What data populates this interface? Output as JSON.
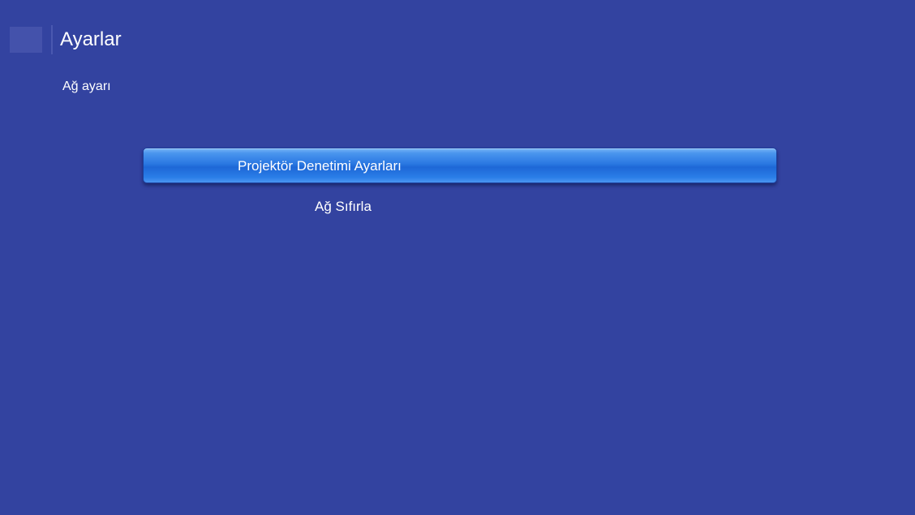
{
  "header": {
    "title": "Ayarlar",
    "icon": "settings-icon"
  },
  "breadcrumb": {
    "label": "Ağ ayarı"
  },
  "menu": {
    "items": [
      {
        "label": "Projektör Denetimi Ayarları",
        "selected": true
      },
      {
        "label": "Ağ Sıfırla",
        "selected": false
      }
    ]
  },
  "colors": {
    "background": "#3343a0",
    "highlight": "#2a78e2",
    "text": "#ffffff"
  }
}
